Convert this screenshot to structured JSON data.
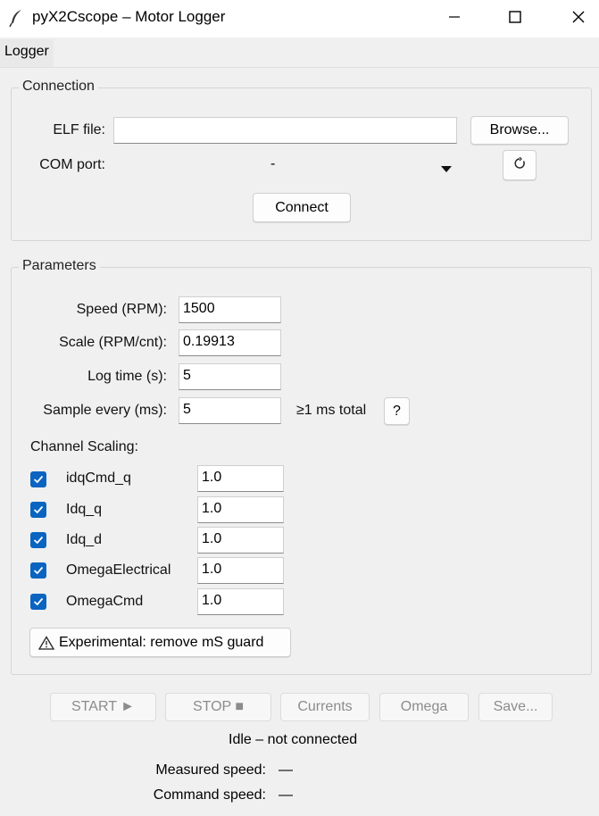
{
  "window": {
    "title": "pyX2Cscope – Motor Logger",
    "controls": {
      "minimize": "minimize",
      "maximize": "maximize",
      "close": "close"
    }
  },
  "menu": {
    "items": [
      {
        "label": "Logger"
      }
    ]
  },
  "connection": {
    "group_title": "Connection",
    "elf_label": "ELF file:",
    "elf_value": "",
    "browse_label": "Browse...",
    "com_label": "COM port:",
    "com_value": "-",
    "refresh_icon": "refresh-icon",
    "connect_label": "Connect"
  },
  "parameters": {
    "group_title": "Parameters",
    "fields": [
      {
        "label": "Speed (RPM):",
        "value": "1500"
      },
      {
        "label": "Scale (RPM/cnt):",
        "value": "0.19913"
      },
      {
        "label": "Log time (s):",
        "value": "5"
      },
      {
        "label": "Sample every (ms):",
        "value": "5"
      }
    ],
    "sample_hint": "≥1 ms total",
    "help_label": "?",
    "channel_scaling_label": "Channel Scaling:",
    "channels": [
      {
        "name": "idqCmd_q",
        "checked": true,
        "scale": "1.0"
      },
      {
        "name": "Idq_q",
        "checked": true,
        "scale": "1.0"
      },
      {
        "name": "Idq_d",
        "checked": true,
        "scale": "1.0"
      },
      {
        "name": "OmegaElectrical",
        "checked": true,
        "scale": "1.0"
      },
      {
        "name": "OmegaCmd",
        "checked": true,
        "scale": "1.0"
      }
    ],
    "experimental_label": "Experimental: remove mS guard",
    "warning_icon": "warning-icon"
  },
  "actions": {
    "start_label": "START ►",
    "stop_label": "STOP ■",
    "currents_label": "Currents",
    "omega_label": "Omega",
    "save_label": "Save..."
  },
  "status": {
    "state": "Idle – not connected",
    "measured_label": "Measured speed:",
    "measured_value": "—",
    "command_label": "Command speed:",
    "command_value": "—"
  },
  "colors": {
    "checkbox": "#0a64c0",
    "background": "#f0f0f0"
  }
}
